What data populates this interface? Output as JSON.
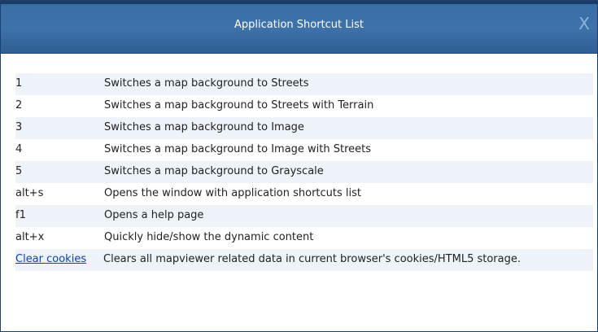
{
  "dialog": {
    "title": "Application Shortcut List",
    "close_symbol": "X"
  },
  "shortcuts": [
    {
      "key": "1",
      "description": "Switches a map background to Streets"
    },
    {
      "key": "2",
      "description": "Switches a map background to Streets with Terrain"
    },
    {
      "key": "3",
      "description": "Switches a map background to Image"
    },
    {
      "key": "4",
      "description": "Switches a map background to Image with Streets"
    },
    {
      "key": "5",
      "description": "Switches a map background to Grayscale"
    },
    {
      "key": "alt+s",
      "description": "Opens the window with application shortcuts list"
    },
    {
      "key": "f1",
      "description": "Opens a help page"
    },
    {
      "key": "alt+x",
      "description": "Quickly hide/show the dynamic content"
    }
  ],
  "clear_cookies": {
    "link_label": "Clear cookies",
    "description": "Clears all mapviewer related data in current browser's cookies/HTML5 storage."
  },
  "colors": {
    "titlebar": "#3e72aa",
    "stripe": "#eef3f9",
    "link": "#0b3fbf"
  },
  "icons": {
    "close": "close-icon"
  }
}
